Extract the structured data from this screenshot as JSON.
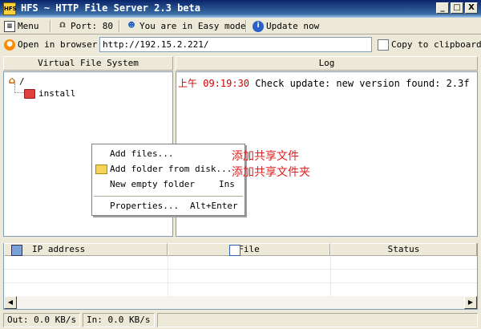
{
  "window": {
    "icon_text": "HFS",
    "title": "HFS ~ HTTP File Server 2.3 beta",
    "minimize": "_",
    "maximize": "□",
    "close": "X"
  },
  "toolbar": {
    "menu": "Menu",
    "port": "Port: 80",
    "mode": "You are in Easy mode",
    "update": "Update now"
  },
  "addressbar": {
    "open_browser": "Open in browser",
    "url": "http://192.15.2.221/",
    "copy": "Copy to clipboard"
  },
  "vfs": {
    "header": "Virtual File System",
    "root": "/",
    "items": [
      "install"
    ]
  },
  "log": {
    "header": "Log",
    "entries": [
      {
        "time": "上午 09:19:30",
        "text": "Check update: new version found: 2.3f"
      }
    ]
  },
  "context_menu": {
    "items": [
      {
        "label": "Add files...",
        "shortcut": ""
      },
      {
        "label": "Add folder from disk...",
        "shortcut": ""
      },
      {
        "label": "New empty folder",
        "shortcut": "Ins"
      },
      {
        "label": "Properties...",
        "shortcut": "Alt+Enter"
      }
    ]
  },
  "annotations": [
    "添加共享文件",
    "添加共享文件夹"
  ],
  "connections": {
    "columns": [
      "IP address",
      "File",
      "Status"
    ]
  },
  "scrollbar": {
    "left": "◀",
    "right": "▶"
  },
  "status": {
    "out": "Out: 0.0 KB/s",
    "in": "In: 0.0 KB/s"
  },
  "colors": {
    "titlebar": "#0A246A",
    "log_time": "#D00000",
    "annotation": "#E02020",
    "folder": "#E04040"
  }
}
